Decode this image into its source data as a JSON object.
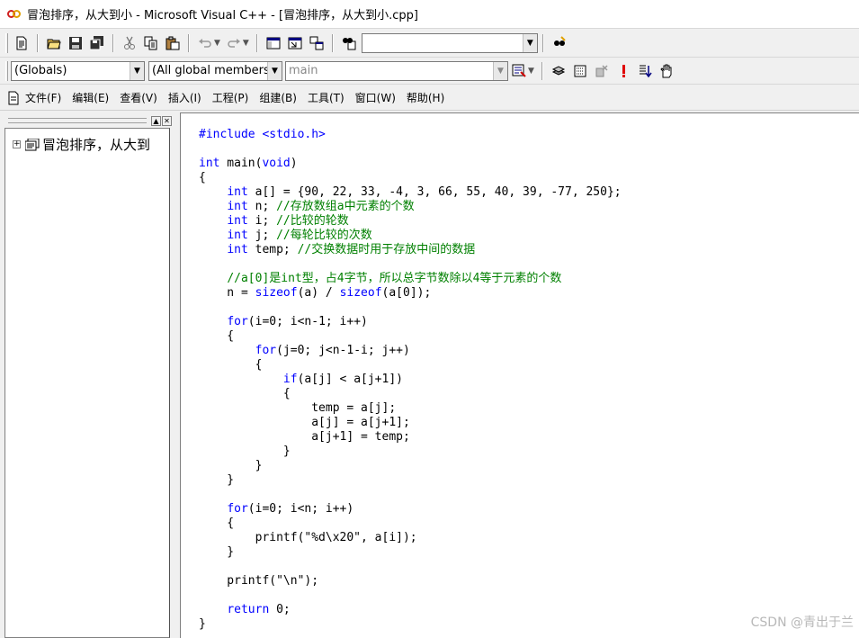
{
  "window": {
    "title": "冒泡排序，从大到小 - Microsoft Visual C++ - [冒泡排序，从大到小.cpp]"
  },
  "toolbar": {
    "find_combo_value": "",
    "icons": [
      "new-file-icon",
      "open-folder-icon",
      "save-icon",
      "save-all-icon",
      "cut-icon",
      "copy-icon",
      "paste-icon",
      "undo-icon",
      "redo-icon",
      "workspace-icon",
      "output-icon",
      "window-list-icon",
      "find-in-files-icon",
      "search-icon"
    ]
  },
  "wizardbar": {
    "class_combo": "(Globals)",
    "filter_combo": "(All global members",
    "member_combo": "main",
    "icons": [
      "wizard-action-icon",
      "compile-icon",
      "build-icon",
      "stop-build-icon",
      "execute-icon",
      "go-icon",
      "insert-breakpoint-icon"
    ]
  },
  "menu": {
    "items": [
      "文件(F)",
      "编辑(E)",
      "查看(V)",
      "插入(I)",
      "工程(P)",
      "组建(B)",
      "工具(T)",
      "窗口(W)",
      "帮助(H)"
    ]
  },
  "workspace": {
    "tree_root": "冒泡排序，从大到"
  },
  "code_lines": [
    [
      {
        "t": "#include <stdio.h>",
        "c": "kw_pre"
      }
    ],
    [],
    [
      {
        "t": "int",
        "c": "kw"
      },
      {
        "t": " main("
      },
      {
        "t": "void",
        "c": "kw"
      },
      {
        "t": ")"
      }
    ],
    [
      {
        "t": "{"
      }
    ],
    [
      {
        "t": "    "
      },
      {
        "t": "int",
        "c": "kw"
      },
      {
        "t": " a[] = {90, 22, 33, -4, 3, 66, 55, 40, 39, -77, 250};"
      }
    ],
    [
      {
        "t": "    "
      },
      {
        "t": "int",
        "c": "kw"
      },
      {
        "t": " n; "
      },
      {
        "t": "//存放数组a中元素的个数",
        "c": "cm"
      }
    ],
    [
      {
        "t": "    "
      },
      {
        "t": "int",
        "c": "kw"
      },
      {
        "t": " i; "
      },
      {
        "t": "//比较的轮数",
        "c": "cm"
      }
    ],
    [
      {
        "t": "    "
      },
      {
        "t": "int",
        "c": "kw"
      },
      {
        "t": " j; "
      },
      {
        "t": "//每轮比较的次数",
        "c": "cm"
      }
    ],
    [
      {
        "t": "    "
      },
      {
        "t": "int",
        "c": "kw"
      },
      {
        "t": " temp; "
      },
      {
        "t": "//交换数据时用于存放中间的数据",
        "c": "cm"
      }
    ],
    [],
    [
      {
        "t": "    "
      },
      {
        "t": "//a[0]是int型，占4字节，所以总字节数除以4等于元素的个数",
        "c": "cm"
      }
    ],
    [
      {
        "t": "    n = "
      },
      {
        "t": "sizeof",
        "c": "kw"
      },
      {
        "t": "(a) / "
      },
      {
        "t": "sizeof",
        "c": "kw"
      },
      {
        "t": "(a[0]);"
      }
    ],
    [],
    [
      {
        "t": "    "
      },
      {
        "t": "for",
        "c": "kw"
      },
      {
        "t": "(i=0; i<n-1; i++)"
      }
    ],
    [
      {
        "t": "    {"
      }
    ],
    [
      {
        "t": "        "
      },
      {
        "t": "for",
        "c": "kw"
      },
      {
        "t": "(j=0; j<n-1-i; j++)"
      }
    ],
    [
      {
        "t": "        {"
      }
    ],
    [
      {
        "t": "            "
      },
      {
        "t": "if",
        "c": "kw"
      },
      {
        "t": "(a[j] < a[j+1])"
      }
    ],
    [
      {
        "t": "            {"
      }
    ],
    [
      {
        "t": "                temp = a[j];"
      }
    ],
    [
      {
        "t": "                a[j] = a[j+1];"
      }
    ],
    [
      {
        "t": "                a[j+1] = temp;"
      }
    ],
    [
      {
        "t": "            }"
      }
    ],
    [
      {
        "t": "        }"
      }
    ],
    [
      {
        "t": "    }"
      }
    ],
    [],
    [
      {
        "t": "    "
      },
      {
        "t": "for",
        "c": "kw"
      },
      {
        "t": "(i=0; i<n; i++)"
      }
    ],
    [
      {
        "t": "    {"
      }
    ],
    [
      {
        "t": "        printf(\"%d\\x20\", a[i]);"
      }
    ],
    [
      {
        "t": "    }"
      }
    ],
    [],
    [
      {
        "t": "    printf(\"\\n\");"
      }
    ],
    [],
    [
      {
        "t": "    "
      },
      {
        "t": "return",
        "c": "kw"
      },
      {
        "t": " 0;"
      }
    ],
    [
      {
        "t": "}"
      }
    ]
  ],
  "watermark": "CSDN @青出于兰",
  "colors": {
    "keyword": "#0000ff",
    "comment": "#008000",
    "text": "#000000"
  }
}
